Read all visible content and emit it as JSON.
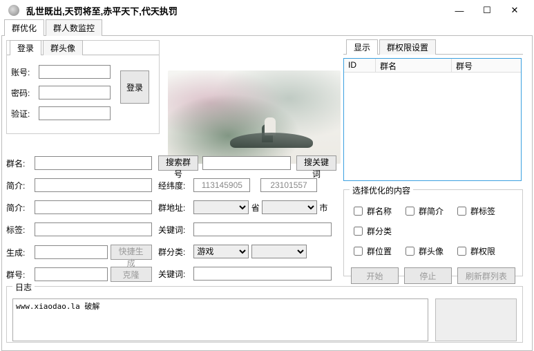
{
  "title": "乱世既出,天罚将至,赤平天下,代天执罚",
  "main_tabs": {
    "t1": "群优化",
    "t2": "群人数监控"
  },
  "login": {
    "tab1": "登录",
    "tab2": "群头像",
    "account_lbl": "账号:",
    "password_lbl": "密码:",
    "verify_lbl": "验证:",
    "login_btn": "登录"
  },
  "fields": {
    "groupname_lbl": "群名:",
    "search_gid_btn": "搜索群号",
    "search_kw_btn": "搜关键词",
    "intro_lbl": "简介:",
    "coord_lbl": "经纬度:",
    "coord_v1": "113145905",
    "coord_v2": "23101557",
    "intro2_lbl": "简介:",
    "addr_lbl": "群地址:",
    "prov_lbl": "省",
    "city_lbl": "市",
    "tag_lbl": "标签:",
    "kw_lbl": "关键词:",
    "gen_lbl": "生成:",
    "quickgen_btn": "快捷生成",
    "cat_lbl": "群分类:",
    "cat_val": "游戏",
    "gid_lbl": "群号:",
    "clone_btn": "克隆",
    "kw2_lbl": "关键词:"
  },
  "right": {
    "tab1": "显示",
    "tab2": "群权限设置",
    "col_id": "ID",
    "col_name": "群名",
    "col_num": "群号",
    "opt_title": "选择优化的内容",
    "c1": "群名称",
    "c2": "群简介",
    "c3": "群标签",
    "c4": "群分类",
    "c5": "群位置",
    "c6": "群头像",
    "c7": "群权限",
    "start_btn": "开始",
    "stop_btn": "停止",
    "refresh_btn": "刷新群列表"
  },
  "log": {
    "title": "日志",
    "text": "www.xiaodao.la 破解"
  }
}
